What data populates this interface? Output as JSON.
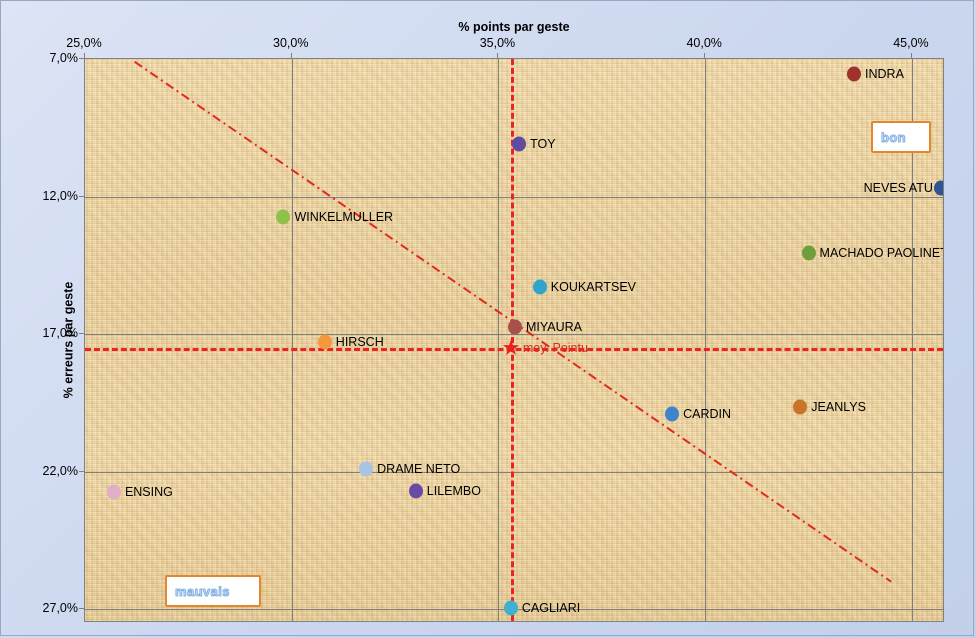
{
  "chart_data": {
    "type": "scatter",
    "title": "",
    "xlabel": "% points par geste",
    "ylabel": "% erreurs par geste",
    "xlim": [
      25.0,
      45.8
    ],
    "ylim": [
      7.0,
      27.5
    ],
    "y_inverted": true,
    "grid": true,
    "legend_position": "none",
    "x_ticks": [
      "25,0%",
      "30,0%",
      "35,0%",
      "40,0%",
      "45,0%"
    ],
    "x_tick_values": [
      25.0,
      30.0,
      35.0,
      40.0,
      45.0
    ],
    "y_ticks": [
      "7,0%",
      "12,0%",
      "17,0%",
      "22,0%",
      "27,0%"
    ],
    "y_tick_values": [
      7.0,
      12.0,
      17.0,
      22.0,
      27.0
    ],
    "points": [
      {
        "label": "INDRA",
        "x": 43.6,
        "y": 7.55,
        "color": "#9e3129",
        "label_side": "right"
      },
      {
        "label": "TOY",
        "x": 35.5,
        "y": 10.1,
        "color": "#5f4ba0",
        "label_side": "right"
      },
      {
        "label": "NEVES ATU",
        "x": 45.7,
        "y": 11.7,
        "color": "#2f5597",
        "label_side": "left"
      },
      {
        "label": "WINKELMULLER",
        "x": 29.8,
        "y": 12.75,
        "color": "#8ec04a",
        "label_side": "right"
      },
      {
        "label": "MACHADO PAOLINETTI",
        "x": 42.5,
        "y": 14.05,
        "color": "#6f9e3c",
        "label_side": "right"
      },
      {
        "label": "KOUKARTSEV",
        "x": 36.0,
        "y": 15.3,
        "color": "#30a5cc",
        "label_side": "right"
      },
      {
        "label": "MIYAURA",
        "x": 35.4,
        "y": 16.75,
        "color": "#a8504a",
        "label_side": "right"
      },
      {
        "label": "HIRSCH",
        "x": 30.8,
        "y": 17.3,
        "color": "#f5983d",
        "label_side": "right"
      },
      {
        "label": "CARDIN",
        "x": 39.2,
        "y": 19.9,
        "color": "#3d85c8",
        "label_side": "right"
      },
      {
        "label": "JEANLYS",
        "x": 42.3,
        "y": 19.65,
        "color": "#c8742a",
        "label_side": "right"
      },
      {
        "label": "DRAME NETO",
        "x": 31.8,
        "y": 21.9,
        "color": "#a8c4e4",
        "label_side": "right"
      },
      {
        "label": "ENSING",
        "x": 25.7,
        "y": 22.75,
        "color": "#e0aec6",
        "label_side": "right"
      },
      {
        "label": "LILEMBO",
        "x": 33.0,
        "y": 22.7,
        "color": "#6a4ba3",
        "label_side": "right"
      },
      {
        "label": "CAGLIARI",
        "x": 35.3,
        "y": 26.95,
        "color": "#3fb0d0",
        "label_side": "right"
      }
    ],
    "mean_marker": {
      "label": "moy. Pointu",
      "x": 35.3,
      "y": 17.5,
      "color": "#e8211b"
    },
    "mean_lines": {
      "vertical_x": 35.3,
      "horizontal_y": 17.5,
      "color": "#ee2222",
      "style": "dashed"
    },
    "trend_line": {
      "style": "dash-dot",
      "color": "#e02b1c",
      "x_start": 26.2,
      "y_start": 7.1,
      "x_end": 44.5,
      "y_end": 26.0
    },
    "annotations": [
      {
        "name": "bon",
        "text": "bon",
        "position": "top-right",
        "border_color": "#e3872f",
        "text_color": "#c9dcf2"
      },
      {
        "name": "mauvais",
        "text": "mauvais",
        "position": "bottom-left",
        "border_color": "#e3872f",
        "text_color": "#c9dcf2"
      }
    ]
  }
}
